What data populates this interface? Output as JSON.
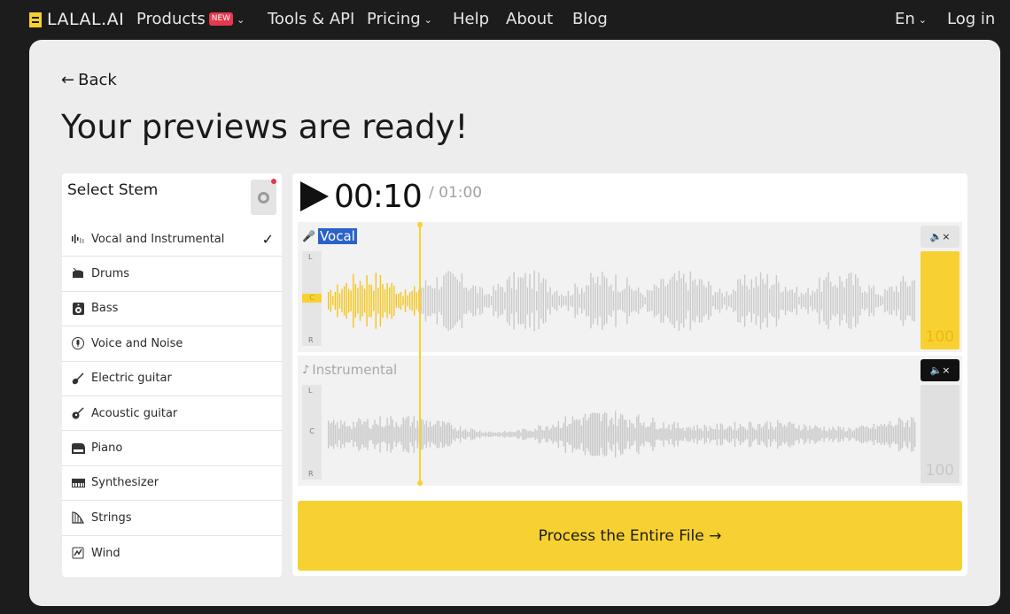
{
  "nav": {
    "logo": "LALAL.AI",
    "items": [
      {
        "label": "Products",
        "badge": "NEW",
        "chevron": true
      },
      {
        "label": "Tools & API"
      },
      {
        "label": "Pricing",
        "chevron": true
      },
      {
        "label": "Help"
      },
      {
        "label": "About"
      },
      {
        "label": "Blog"
      }
    ],
    "language": "En",
    "login": "Log in"
  },
  "page": {
    "back": "Back",
    "title": "Your previews are ready!"
  },
  "stem_panel": {
    "title": "Select Stem",
    "items": [
      {
        "label": "Vocal and Instrumental",
        "icon": "waveform-icon",
        "selected": true
      },
      {
        "label": "Drums",
        "icon": "drum-icon"
      },
      {
        "label": "Bass",
        "icon": "speaker-icon"
      },
      {
        "label": "Voice and Noise",
        "icon": "voice-icon"
      },
      {
        "label": "Electric guitar",
        "icon": "electric-guitar-icon"
      },
      {
        "label": "Acoustic guitar",
        "icon": "acoustic-guitar-icon"
      },
      {
        "label": "Piano",
        "icon": "piano-icon"
      },
      {
        "label": "Synthesizer",
        "icon": "synth-icon"
      },
      {
        "label": "Strings",
        "icon": "harp-icon"
      },
      {
        "label": "Wind",
        "icon": "wind-icon"
      }
    ]
  },
  "player": {
    "current_time": "00:10",
    "total_time": "/ 01:00",
    "tracks": [
      {
        "label": "Vocal",
        "volume": "100",
        "muted": false,
        "center": "C"
      },
      {
        "label": "Instrumental",
        "volume": "100",
        "muted": true,
        "center": "C"
      }
    ],
    "lr": {
      "l": "L",
      "r": "R"
    },
    "progress": 0.1667,
    "process_button": "Process the Entire File →"
  },
  "colors": {
    "accent": "#f7d131",
    "background": "#1c1c1c",
    "card": "#ededed",
    "badge": "#e5384f"
  }
}
